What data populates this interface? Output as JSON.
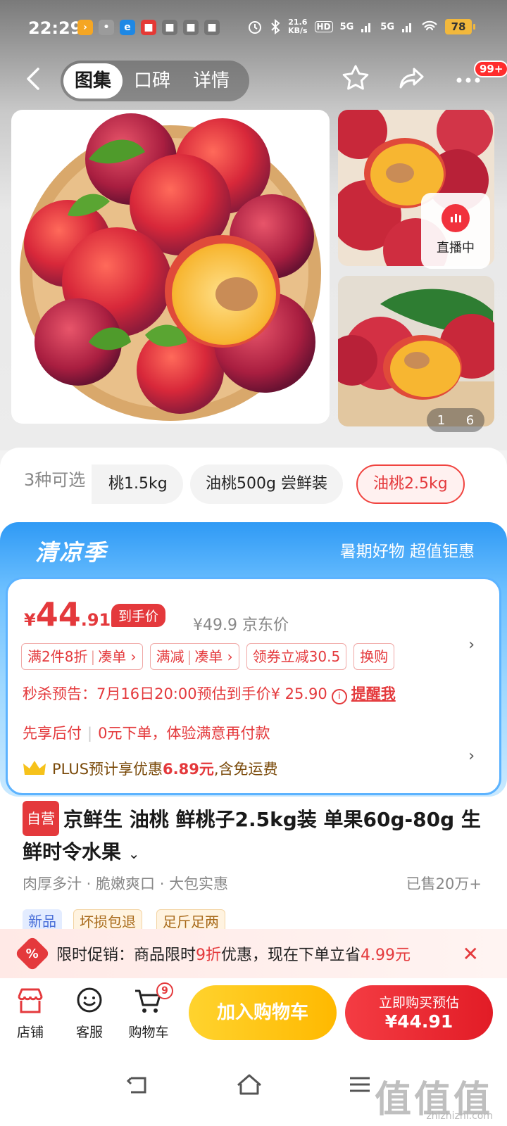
{
  "status_bar": {
    "time": "22:29",
    "net_speed_value": "21.6",
    "net_speed_unit": "KB/s",
    "signal1": "5G",
    "signal2": "5G",
    "battery": "78"
  },
  "nav": {
    "tabs": [
      "图集",
      "口碑",
      "详情"
    ],
    "active_tab": "图集",
    "message_badge": "99+"
  },
  "gallery": {
    "live_label": "直播中",
    "page_current": "1",
    "page_total": "6"
  },
  "variants": {
    "label": "3种可选",
    "options": [
      "桃1.5kg",
      "油桃500g 尝鲜装",
      "油桃2.5kg"
    ],
    "selected": "油桃2.5kg"
  },
  "promo_banner": {
    "season": "清凉季",
    "slogan": "暑期好物 超值钜惠"
  },
  "price": {
    "currency": "¥",
    "integer": "44",
    "decimal": ".91",
    "tag": "到手价",
    "jd_price": "¥49.9",
    "jd_label": "京东价"
  },
  "promotions": [
    {
      "main": "满2件8折",
      "action": "凑单"
    },
    {
      "main": "满减",
      "action": "凑单"
    },
    {
      "main": "领券立减30.5",
      "action": ""
    },
    {
      "main": "换购",
      "action": ""
    }
  ],
  "seckill": {
    "text": "秒杀预告：7月16日20:00预估到手价¥ 25.90",
    "remind": "提醒我"
  },
  "pay_later": {
    "label": "先享后付",
    "desc": "0元下单，体验满意再付款"
  },
  "plus": {
    "prefix": "PLUS预计享优惠",
    "amount": "6.89元",
    "suffix": ",含免运费"
  },
  "product": {
    "self_tag": "自营",
    "title": "京鲜生 油桃 鲜桃子2.5kg装 单果60g-80g 生鲜时令水果",
    "features": [
      "肉厚多汁",
      "脆嫩爽口",
      "大包实惠"
    ],
    "sold": "已售20万+",
    "tags": [
      "新品",
      "坏损包退",
      "足斤足两"
    ]
  },
  "limited_promo": {
    "label": "限时促销：商品限时",
    "discount": "9折",
    "middle": "优惠，现在下单立省",
    "save": "4.99元"
  },
  "bottom_bar": {
    "store": "店铺",
    "service": "客服",
    "cart": "购物车",
    "cart_count": "9",
    "add_to_cart": "加入购物车",
    "buy_label": "立即购买预估",
    "buy_price": "¥44.91"
  },
  "watermark": {
    "text": "值值值",
    "url": "zhizhizhi.com"
  },
  "colors": {
    "accent_red": "#e4393c",
    "cart_yellow": "#ffc107",
    "promo_blue": "#2f9af5"
  }
}
